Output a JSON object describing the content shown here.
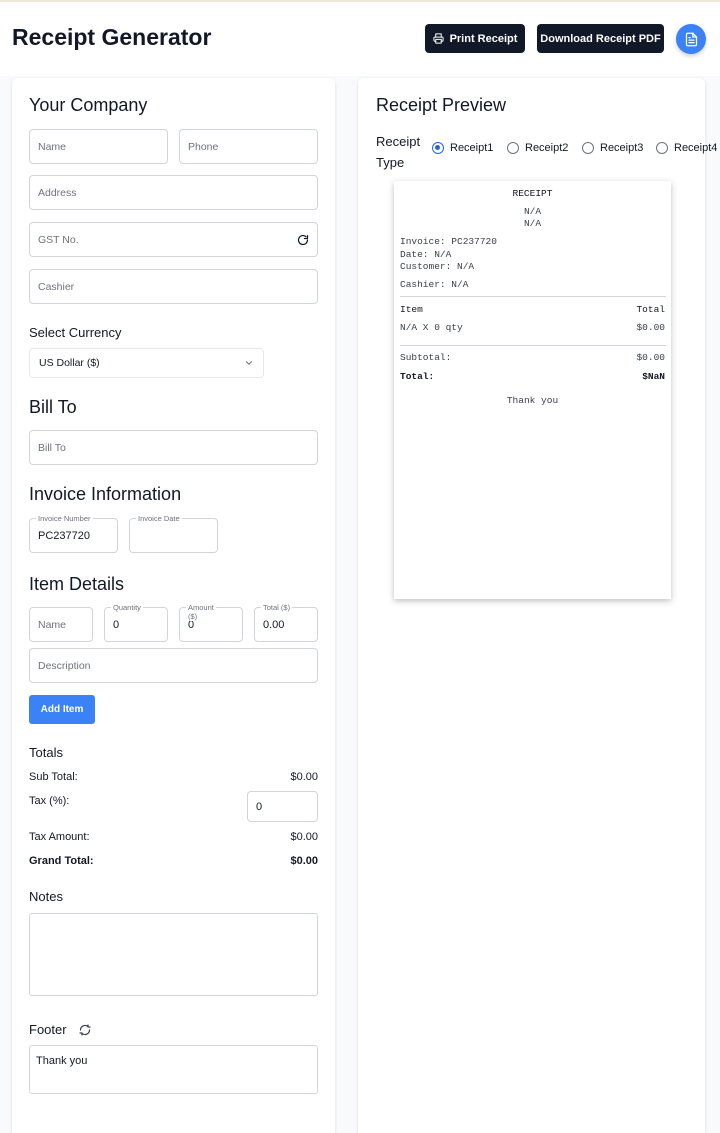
{
  "header": {
    "title": "Receipt Generator",
    "print_label": "Print Receipt",
    "download_label": "Download Receipt PDF"
  },
  "company": {
    "heading": "Your Company",
    "name_placeholder": "Name",
    "phone_placeholder": "Phone",
    "address_placeholder": "Address",
    "gst_placeholder": "GST No.",
    "cashier_placeholder": "Cashier",
    "currency_label": "Select Currency",
    "currency_value": "US Dollar ($)"
  },
  "bill_to": {
    "heading": "Bill To",
    "placeholder": "Bill To"
  },
  "invoice": {
    "heading": "Invoice Information",
    "number_label": "Invoice Number",
    "number_value": "PC237720",
    "date_label": "Invoice Date",
    "date_value": ""
  },
  "items": {
    "heading": "Item Details",
    "name_placeholder": "Name",
    "quantity_label": "Quantity",
    "quantity_value": "0",
    "amount_label": "Amount ($)",
    "amount_value": "0",
    "total_label": "Total ($)",
    "total_value": "0.00",
    "description_placeholder": "Description",
    "add_label": "Add Item"
  },
  "totals": {
    "heading": "Totals",
    "subtotal_label": "Sub Total:",
    "subtotal_value": "$0.00",
    "tax_label": "Tax (%):",
    "tax_value": "0",
    "tax_amount_label": "Tax Amount:",
    "tax_amount_value": "$0.00",
    "grand_label": "Grand Total:",
    "grand_value": "$0.00"
  },
  "notes": {
    "heading": "Notes",
    "value": ""
  },
  "footer": {
    "heading": "Footer",
    "value": "Thank you"
  },
  "preview": {
    "heading": "Receipt Preview",
    "type_label_line1": "Receipt",
    "type_label_line2": "Type",
    "options": [
      "Receipt1",
      "Receipt2",
      "Receipt3",
      "Receipt4"
    ],
    "selected": "Receipt1"
  },
  "receipt": {
    "title": "RECEIPT",
    "company_line1": "N/A",
    "company_line2": "N/A",
    "invoice": "Invoice: PC237720",
    "date": "Date: N/A",
    "customer": "Customer: N/A",
    "cashier": "Cashier: N/A",
    "col_item": "Item",
    "col_total": "Total",
    "item_line": "N/A X 0 qty",
    "item_total": "$0.00",
    "subtotal_label": "Subtotal:",
    "subtotal_value": "$0.00",
    "total_label": "Total:",
    "total_value": "$NaN",
    "footer": "Thank you"
  },
  "icons": {
    "print": "printer-icon",
    "refresh": "refresh-icon",
    "chevron": "chevron-down-icon",
    "document": "document-icon"
  },
  "colors": {
    "primary_dark": "#111827",
    "accent_blue": "#3b82f6"
  }
}
